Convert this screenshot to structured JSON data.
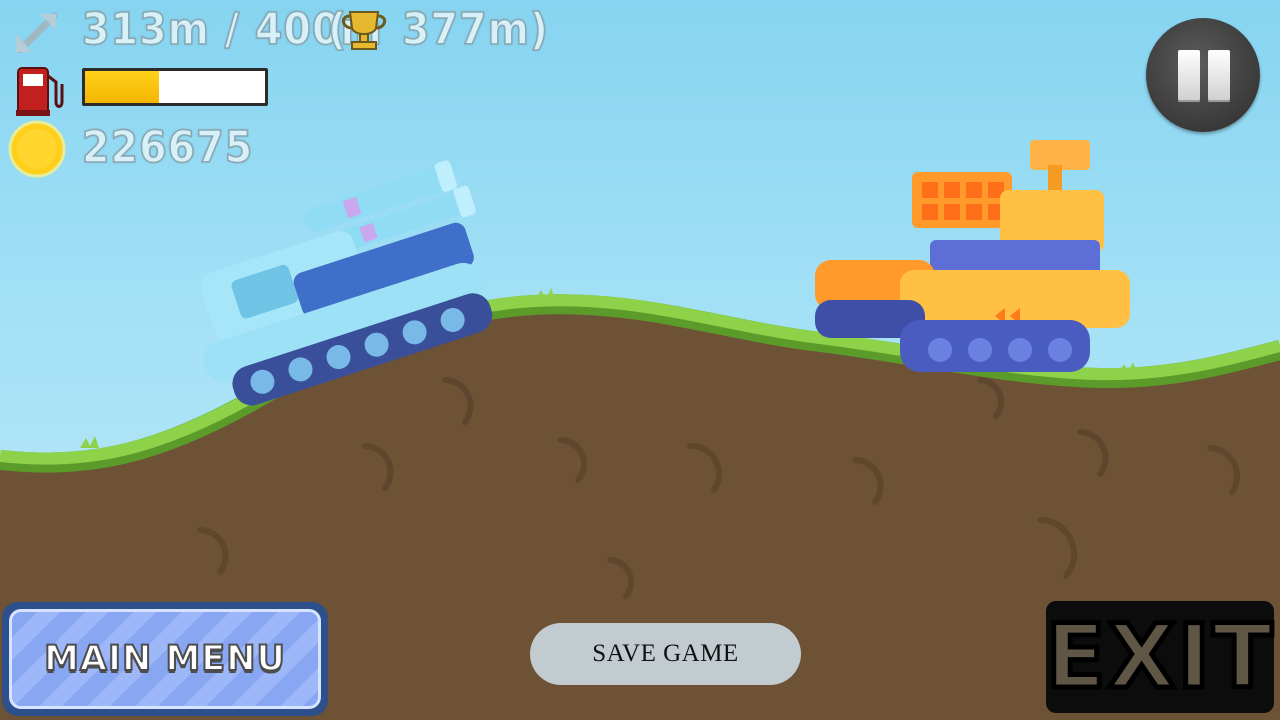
{
  "hud": {
    "distance": "313m / 400m",
    "record_open": "(",
    "record": "377m)",
    "coins": "226675",
    "fuel_level": 0.41
  },
  "buttons": {
    "main_menu": "MAIN MENU",
    "save_game": "SAVE GAME",
    "exit": "EXIT"
  },
  "icons": {
    "distance": "diagonal-arrow-icon",
    "record": "trophy-icon",
    "fuel": "fuel-pump-icon",
    "coins": "coin-icon",
    "pause": "pause-icon"
  },
  "colors": {
    "sky": "#8fd8f3",
    "grass": "#79c53a",
    "dirt": "#6f5438",
    "fuel_fill": "#f7c400",
    "player_tank": "#7fd3ee",
    "enemy_tank": "#ffb63a"
  }
}
